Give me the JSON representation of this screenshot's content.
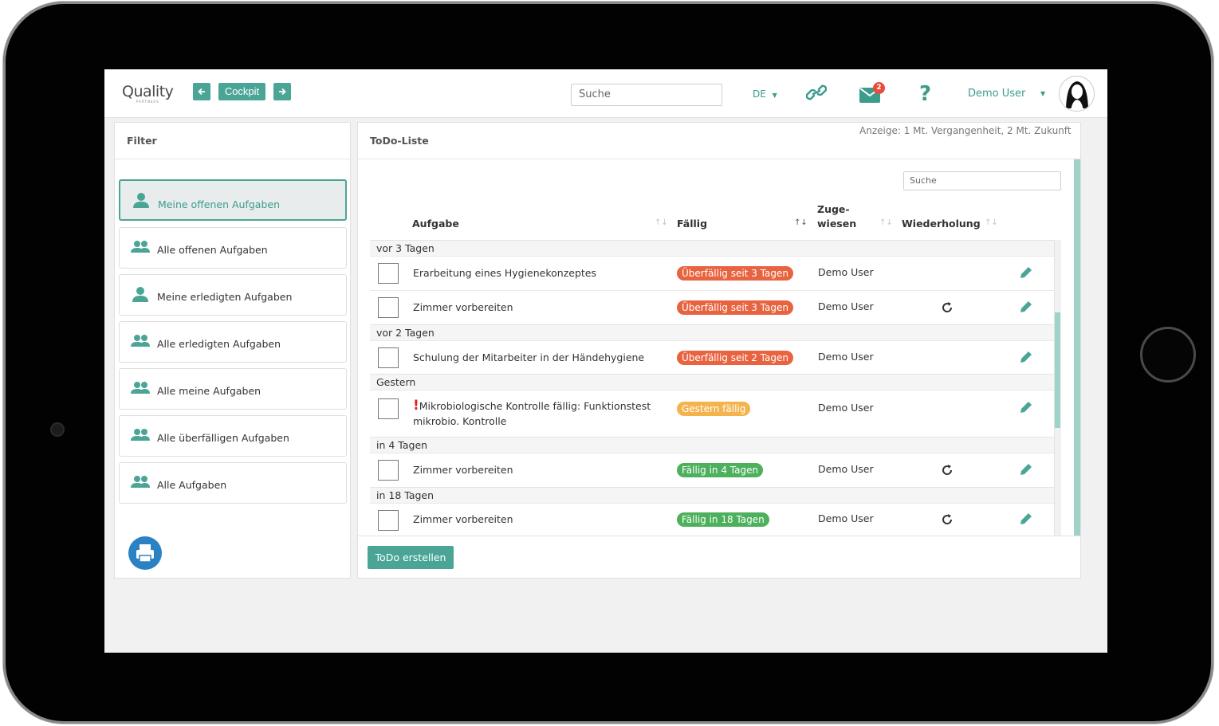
{
  "header": {
    "logo_text": "Quality",
    "logo_sub": "PARTNERS",
    "back_icon": "arrow-left-icon",
    "cockpit_label": "Cockpit",
    "forward_icon": "arrow-right-icon",
    "search_placeholder": "Suche",
    "language": "DE",
    "link_icon": "link-icon",
    "mail_icon": "mail-icon",
    "mail_badge": "2",
    "help_label": "?",
    "user_name": "Demo User"
  },
  "filter": {
    "title": "Filter",
    "items": [
      {
        "label": "Meine offenen Aufgaben",
        "icon": "single-user-icon"
      },
      {
        "label": "Alle offenen Aufgaben",
        "icon": "group-icon"
      },
      {
        "label": "Meine erledigten Aufgaben",
        "icon": "single-user-icon"
      },
      {
        "label": "Alle erledigten Aufgaben",
        "icon": "group-icon"
      },
      {
        "label": "Alle meine Aufgaben",
        "icon": "group-icon"
      },
      {
        "label": "Alle überfälligen Aufgaben",
        "icon": "group-icon"
      },
      {
        "label": "Alle Aufgaben",
        "icon": "group-icon"
      }
    ],
    "print_icon": "printer-icon"
  },
  "todo": {
    "title": "ToDo-Liste",
    "display_note": "Anzeige: 1 Mt. Vergangenheit, 2 Mt. Zukunft",
    "search_placeholder": "Suche",
    "columns": {
      "task": "Aufgabe",
      "due": "Fällig",
      "assigned_1": "Zuge-",
      "assigned_2": "wiesen",
      "repeat": "Wiederholung"
    },
    "groups": [
      {
        "label": "vor 3 Tagen"
      },
      {
        "label": "vor 2 Tagen"
      },
      {
        "label": "Gestern"
      },
      {
        "label": "in 4 Tagen"
      },
      {
        "label": "in 18 Tagen"
      }
    ],
    "rows": [
      {
        "task": "Erarbeitung eines Hygienekonzeptes",
        "due": "Überfällig seit 3 Tagen",
        "assignee": "Demo User"
      },
      {
        "task": "Zimmer vorbereiten",
        "due": "Überfällig seit 3 Tagen",
        "assignee": "Demo User"
      },
      {
        "task": "Schulung der Mitarbeiter in der Händehygiene",
        "due": "Überfällig seit 2 Tagen",
        "assignee": "Demo User"
      },
      {
        "task_mark": "!",
        "task_line1": "Mikrobiologische Kontrolle fällig: Funktionstest",
        "task_line2": "mikrobio. Kontrolle",
        "due": "Gestern fällig",
        "assignee": "Demo User"
      },
      {
        "task": "Zimmer vorbereiten",
        "due": "Fällig in 4 Tagen",
        "assignee": "Demo User"
      },
      {
        "task": "Zimmer vorbereiten",
        "due": "Fällig in 18 Tagen",
        "assignee": "Demo User"
      }
    ],
    "create_button": "ToDo erstellen"
  },
  "colors": {
    "accent": "#4aa596",
    "overdue": "#e8633f",
    "due_today": "#f5b34d",
    "due_future": "#4cb05c",
    "print": "#2a82c4"
  }
}
